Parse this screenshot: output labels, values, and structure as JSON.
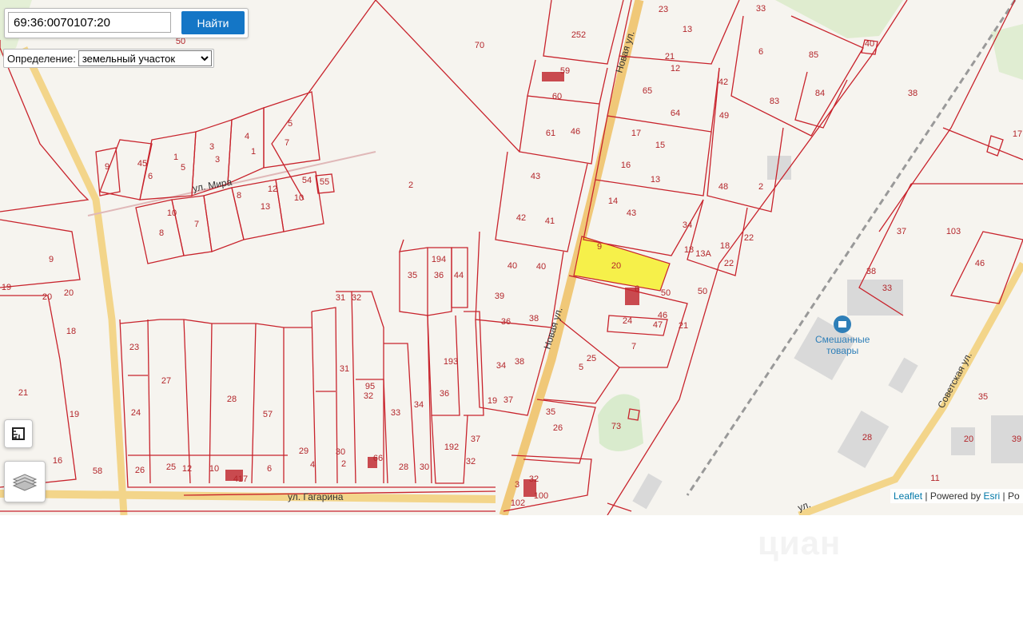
{
  "search": {
    "value": "69:36:0070107:20",
    "button_label": "Найти"
  },
  "definition": {
    "label": "Определение:",
    "selected": "земельный участок"
  },
  "attribution": {
    "leaflet": "Leaflet",
    "sep1": " | Powered by ",
    "esri": "Esri",
    "tail": " | Po"
  },
  "watermark": "циан",
  "map": {
    "streets": {
      "novaya_upper": "Новая ул.",
      "novaya_lower": "Новая ул.",
      "mira": "ул. Мира",
      "gagarina": "ул. Гагарина",
      "sovetskaya": "Советская ул.",
      "bottom": "ул."
    },
    "poi": {
      "name_line1": "Смешанные",
      "name_line2": "товары"
    },
    "highlight_label": "20",
    "parcel_labels": [
      "50",
      "70",
      "252",
      "59",
      "60",
      "61",
      "46",
      "23",
      "13",
      "21",
      "12",
      "65",
      "64",
      "17",
      "15",
      "16",
      "13",
      "14",
      "43",
      "42",
      "49",
      "33",
      "85",
      "83",
      "84",
      "40",
      "38",
      "48",
      "2",
      "6",
      "5",
      "4",
      "3",
      "1",
      "45",
      "9",
      "7",
      "1",
      "3",
      "5",
      "6",
      "8",
      "12",
      "13",
      "10",
      "54",
      "55",
      "2",
      "10",
      "7",
      "8",
      "9",
      "19",
      "20",
      "20",
      "18",
      "21",
      "19",
      "16",
      "58",
      "23",
      "27",
      "28",
      "57",
      "24",
      "26",
      "25",
      "12",
      "10",
      "417",
      "6",
      "29",
      "4",
      "2",
      "30",
      "31",
      "32",
      "31",
      "32",
      "66",
      "95",
      "33",
      "34",
      "35",
      "194",
      "36",
      "44",
      "193",
      "36",
      "192",
      "37",
      "32",
      "28",
      "30",
      "43",
      "42",
      "41",
      "40",
      "40",
      "39",
      "36",
      "38",
      "34",
      "38",
      "19",
      "37",
      "34",
      "18",
      "13А",
      "18",
      "22",
      "22",
      "50",
      "21",
      "50",
      "46",
      "47",
      "24",
      "7",
      "5",
      "25",
      "35",
      "26",
      "73",
      "3",
      "32",
      "100",
      "102",
      "103",
      "46",
      "38",
      "33",
      "37",
      "35",
      "20",
      "39",
      "28",
      "11",
      "17",
      "9",
      "6"
    ],
    "highlight_color": "#f6f04a",
    "parcel_color": "#c8232c",
    "road_color": "#f3d58a"
  }
}
